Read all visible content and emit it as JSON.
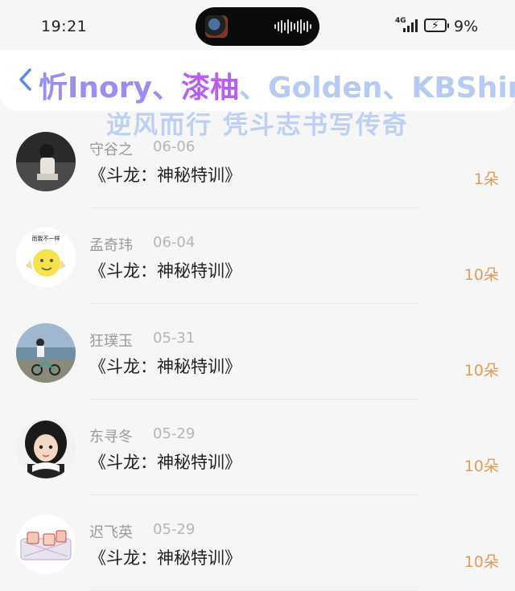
{
  "status": {
    "time": "19:21",
    "network": "4G",
    "battery": "9%"
  },
  "header": {
    "back_icon": "chevron-left-icon",
    "title_part1": "忻Inory、",
    "title_part2": "漆柚",
    "title_part3": "、Golden、KBShinya",
    "subtitle": "逆风而行 凭斗志书写传奇"
  },
  "items": [
    {
      "name": "守谷之",
      "date": "06-06",
      "book": "《斗龙：神秘特训》",
      "count": "1朵"
    },
    {
      "name": "孟奇玮",
      "date": "06-04",
      "book": "《斗龙：神秘特训》",
      "count": "10朵"
    },
    {
      "name": "狂璞玉",
      "date": "05-31",
      "book": "《斗龙：神秘特训》",
      "count": "10朵"
    },
    {
      "name": "东寻冬",
      "date": "05-29",
      "book": "《斗龙：神秘特训》",
      "count": "10朵"
    },
    {
      "name": "迟飞英",
      "date": "05-29",
      "book": "《斗龙：神秘特训》",
      "count": "10朵"
    }
  ],
  "avatar_texts": {
    "item1": "而我不一样"
  },
  "colors": {
    "accent": "#4e8cf5",
    "count": "#e09a5c",
    "title_purple": "#b95ff0"
  }
}
